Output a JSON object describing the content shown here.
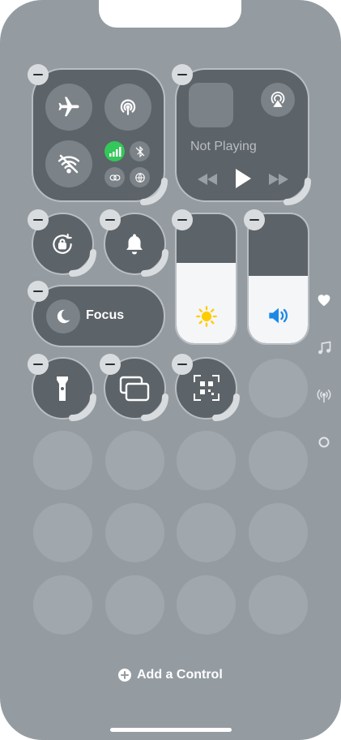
{
  "media": {
    "status": "Not Playing"
  },
  "focus": {
    "label": "Focus"
  },
  "footer": {
    "add_label": "Add a Control"
  },
  "sliders": {
    "brightness_level": 0.62,
    "volume_level": 0.52
  },
  "colors": {
    "background": "#949ca2",
    "tile": "#5c6369",
    "cellular_active": "#34c759",
    "brightness_icon": "#ffcc00",
    "volume_icon": "#1e88e5"
  },
  "side_pages": [
    "heart-icon",
    "music-note-icon",
    "antenna-icon",
    "circle-icon"
  ]
}
